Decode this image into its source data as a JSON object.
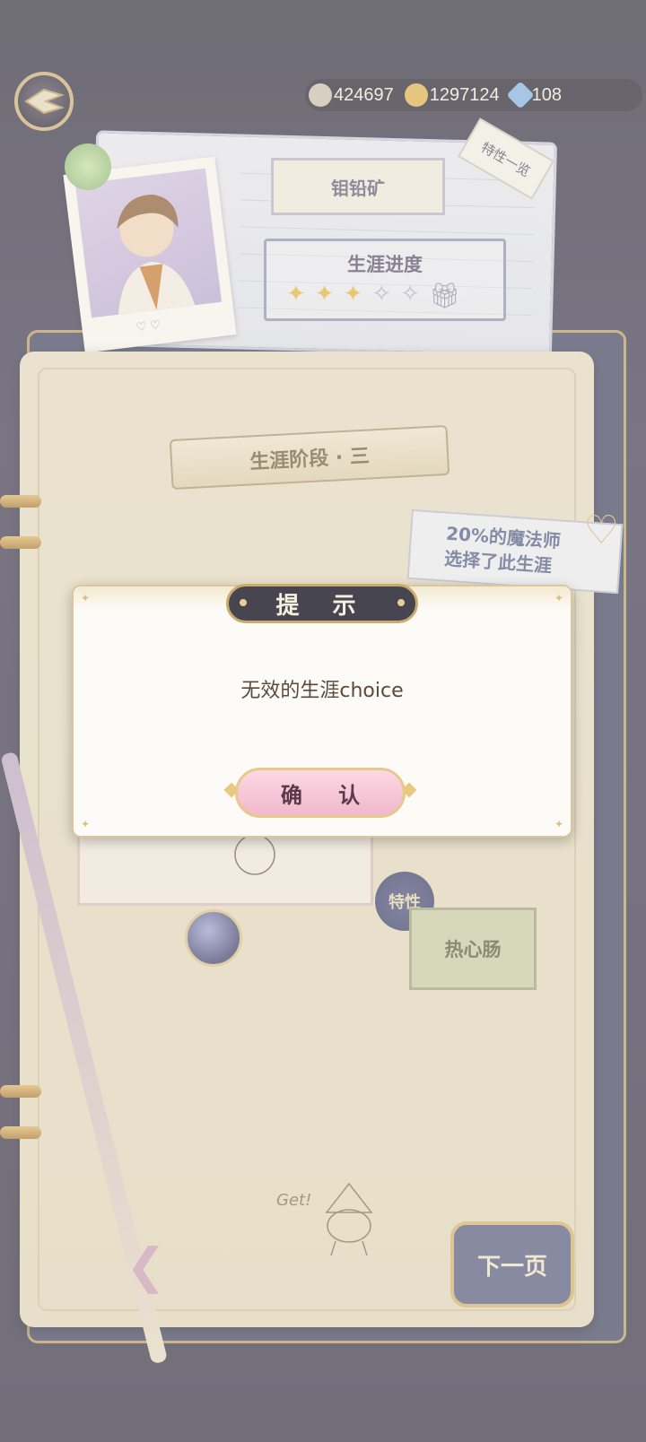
{
  "currency": [
    {
      "icon": "seashell-icon",
      "value": "424697",
      "color": "#c9c2b0"
    },
    {
      "icon": "gold-coin-icon",
      "value": "1297124",
      "color": "#e1b24a"
    },
    {
      "icon": "blue-crystal-icon",
      "value": "108",
      "color": "#7fb2e6"
    }
  ],
  "profile": {
    "name": "钼铅矿",
    "career_title": "生涯进度",
    "corner_tab": "特性一览",
    "progress_stars_filled": 3,
    "progress_stars_total": 5
  },
  "stage": {
    "ribbon": "生涯阶段 · 三"
  },
  "stat_card": {
    "line1": "20%的魔法师",
    "line2": "选择了此生涯"
  },
  "trait": {
    "stamp": "特性",
    "card": "热心肠"
  },
  "doodle": {
    "text": "Get!"
  },
  "nav": {
    "next_page": "下一页"
  },
  "dialog": {
    "title": "提 示",
    "message": "无效的生涯choice",
    "confirm": "确 认"
  }
}
